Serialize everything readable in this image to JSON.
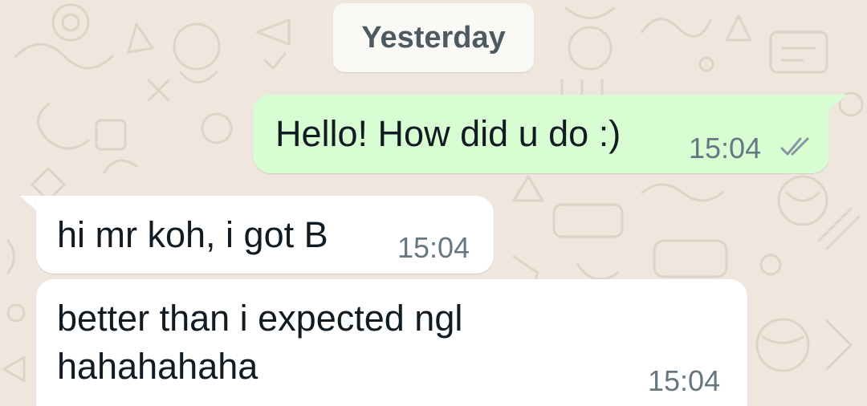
{
  "chat": {
    "date_separator": "Yesterday",
    "messages": [
      {
        "direction": "outgoing",
        "text": "Hello! How did u do :)",
        "time": "15:04",
        "status": "double-check-icon"
      },
      {
        "direction": "incoming",
        "text": "hi mr koh, i got B",
        "time": "15:04"
      },
      {
        "direction": "incoming",
        "lines": [
          "better than i expected ngl",
          "hahahahaha"
        ],
        "time": "15:04"
      }
    ]
  },
  "colors": {
    "wallpaper": "#efe7dd",
    "doodle_stroke": "#ddd3c6",
    "outgoing_bubble": "#d9fdd3",
    "incoming_bubble": "#ffffff",
    "text": "#111b21",
    "meta_text": "#667781",
    "date_chip_text": "#4d5a61"
  }
}
